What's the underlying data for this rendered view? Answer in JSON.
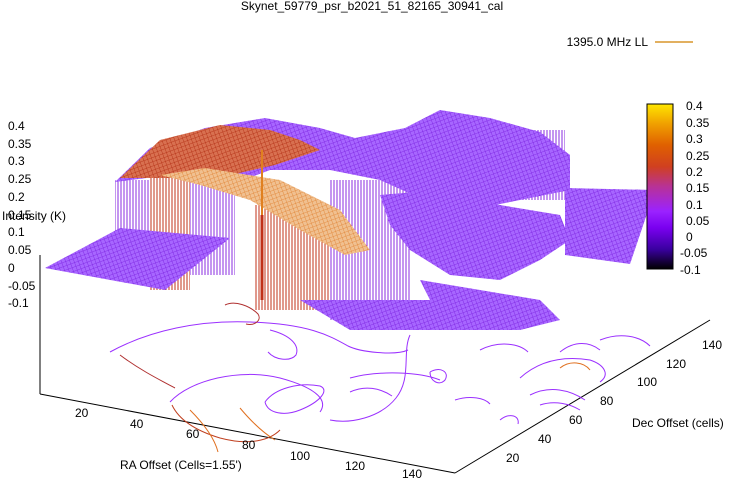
{
  "chart_data": {
    "type": "surface3d",
    "title": "Skynet_59779_psr_b2021_51_82165_30941_cal",
    "legend": {
      "series_name": "1395.0 MHz LL",
      "placement": "top-right"
    },
    "xlabel": "RA Offset (Cells=1.55')",
    "ylabel": "Dec Offset (cells)",
    "zlabel": "Intensity (K)",
    "x_ticks": [
      "20",
      "40",
      "60",
      "80",
      "100",
      "120",
      "140"
    ],
    "y_ticks": [
      "20",
      "40",
      "60",
      "80",
      "100",
      "120",
      "140"
    ],
    "z_ticks": [
      "0.4",
      "0.35",
      "0.3",
      "0.25",
      "0.2",
      "0.15",
      "0.1",
      "0.05",
      "0",
      "-0.05",
      "-0.1"
    ],
    "xlim": [
      1,
      150
    ],
    "ylim": [
      1,
      150
    ],
    "zlim": [
      -0.1,
      0.4
    ],
    "colorbar": {
      "range": [
        -0.1,
        0.4
      ],
      "ticks": [
        "0.4",
        "0.35",
        "0.3",
        "0.25",
        "0.2",
        "0.15",
        "0.1",
        "0.05",
        "0",
        "-0.05",
        "-0.1"
      ],
      "palette": [
        "#000000",
        "#3a00a0",
        "#7a00f0",
        "#9b22ff",
        "#b83296",
        "#d04020",
        "#e06000",
        "#f0a000",
        "#ffe600"
      ]
    },
    "colors": {
      "base_plane": "#8a2be2",
      "surface": "#9b30ff",
      "ridge": "#c84018",
      "peak": "#f0a040"
    },
    "contour_projection": true
  }
}
